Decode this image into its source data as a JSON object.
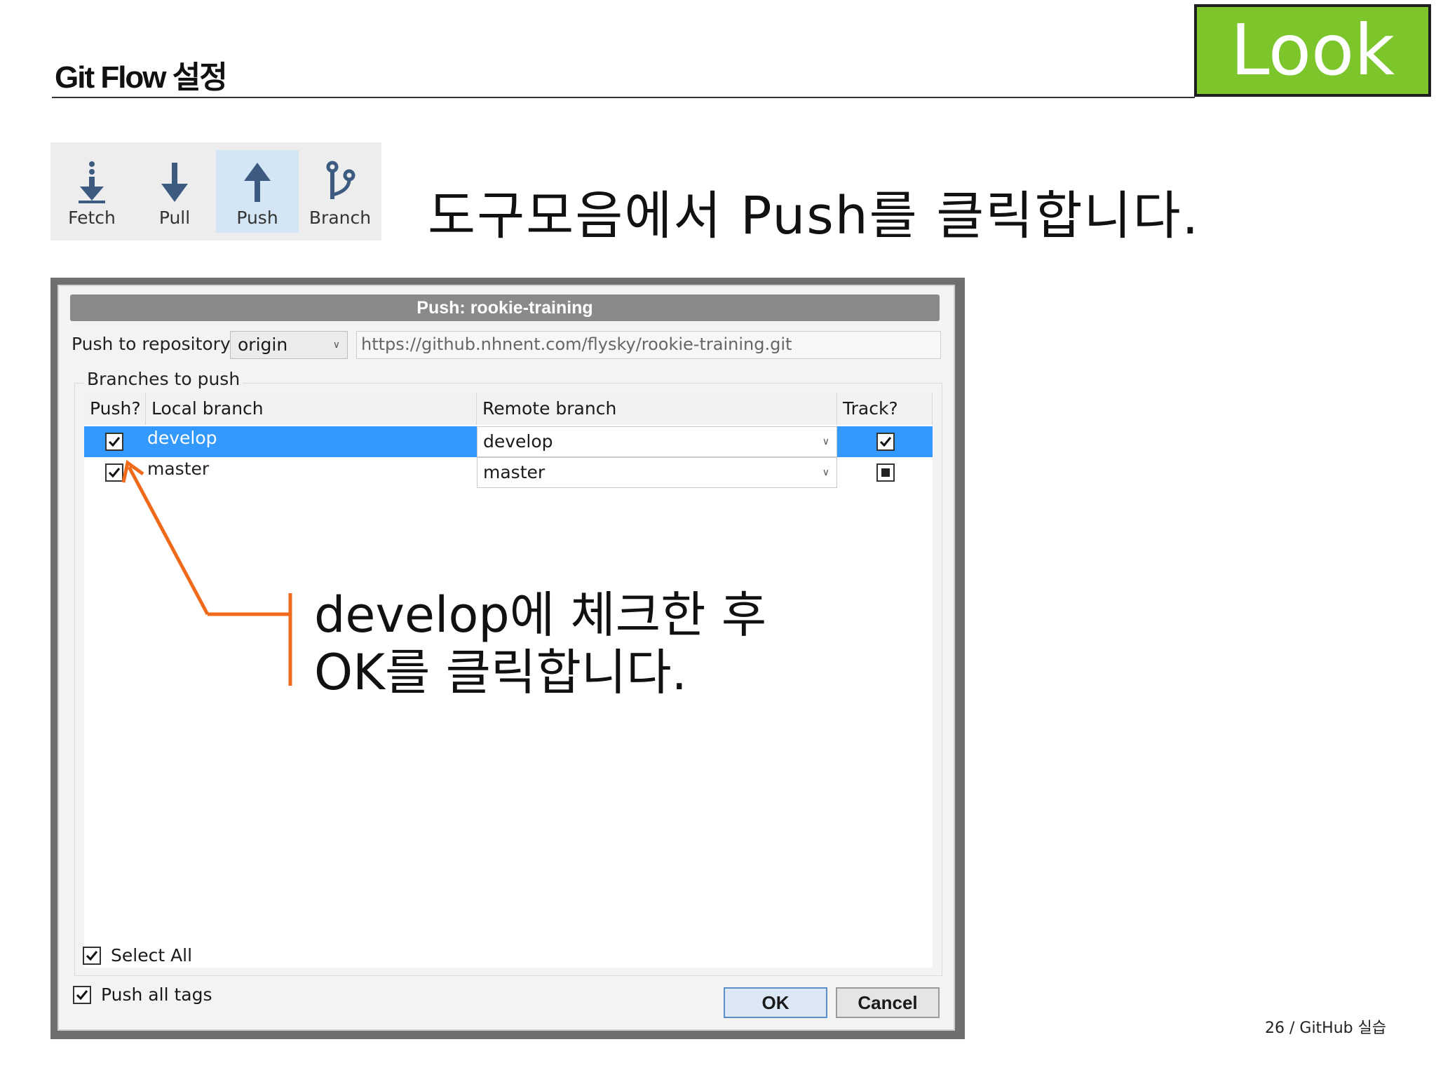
{
  "slide": {
    "title": "Git Flow 설정",
    "badge": "Look",
    "instruction": "도구모음에서 Push를 클릭합니다.",
    "annotation_line1": "develop에 체크한 후",
    "annotation_line2": "OK를 클릭합니다.",
    "page_number": "26 / GitHub 실습",
    "accent_color": "#7cc52b",
    "arrow_color": "#f06a1c"
  },
  "toolbar": {
    "items": [
      {
        "label": "Fetch",
        "icon": "fetch-icon",
        "active": false
      },
      {
        "label": "Pull",
        "icon": "pull-arrow-down-icon",
        "active": false
      },
      {
        "label": "Push",
        "icon": "push-arrow-up-icon",
        "active": true
      },
      {
        "label": "Branch",
        "icon": "branch-icon",
        "active": false
      }
    ]
  },
  "dialog": {
    "title": "Push: rookie-training",
    "push_to_repository_label": "Push to repository:",
    "repository_selected": "origin",
    "repository_url": "https://github.nhnent.com/flysky/rookie-training.git",
    "branches_group_label": "Branches to push",
    "columns": [
      "Push?",
      "Local branch",
      "Remote branch",
      "Track?"
    ],
    "rows": [
      {
        "push": true,
        "local": "develop",
        "remote": "develop",
        "track": "checked",
        "selected": true
      },
      {
        "push": true,
        "local": "master",
        "remote": "master",
        "track": "indeterminate",
        "selected": false
      }
    ],
    "select_all_label": "Select All",
    "select_all_checked": true,
    "push_all_tags_label": "Push all tags",
    "push_all_tags_checked": true,
    "ok_label": "OK",
    "cancel_label": "Cancel"
  }
}
